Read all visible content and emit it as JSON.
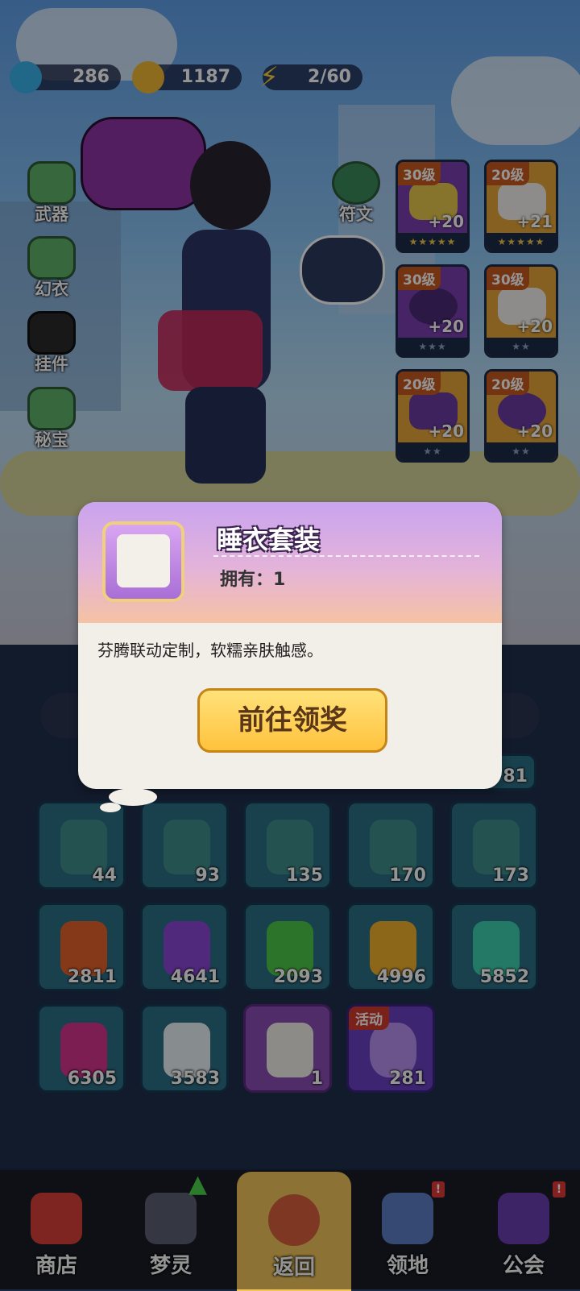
{
  "currencies": {
    "gems": "286",
    "coins": "1187",
    "energy": "2/60"
  },
  "side_menu": [
    {
      "label": "武器"
    },
    {
      "label": "幻衣"
    },
    {
      "label": "挂件"
    },
    {
      "label": "秘宝"
    }
  ],
  "rune_label": "符文",
  "equipment": [
    {
      "level": "30级",
      "bonus": "+20",
      "stars": "★★★★★"
    },
    {
      "level": "20级",
      "bonus": "+21",
      "stars": "★★★★★"
    },
    {
      "level": "30级",
      "bonus": "+20",
      "stars": "★★★"
    },
    {
      "level": "30级",
      "bonus": "+20",
      "stars": "★★"
    },
    {
      "level": "20级",
      "bonus": "+20",
      "stars": "★★"
    },
    {
      "level": "20级",
      "bonus": "+20",
      "stars": "★★"
    }
  ],
  "popup": {
    "title": "睡衣套装",
    "owned": "拥有：1",
    "description": "芬腾联动定制，软糯亲肤触感。",
    "button": "前往领奖"
  },
  "inventory": {
    "row0_partial": [
      "81"
    ],
    "row1": [
      "44",
      "93",
      "135",
      "170",
      "173"
    ],
    "row2": [
      "2811",
      "4641",
      "2093",
      "4996",
      "5852"
    ],
    "row3": [
      "6305",
      "3583",
      "1",
      "281"
    ],
    "event_tag": "活动"
  },
  "nav": [
    {
      "label": "商店"
    },
    {
      "label": "梦灵"
    },
    {
      "label": "返回"
    },
    {
      "label": "领地",
      "badge": "!"
    },
    {
      "label": "公会",
      "badge": "!"
    }
  ],
  "colors": {
    "accent_yellow": "#ffc23d",
    "popup_header": "#c9a4ef",
    "cell_teal": "#2c6e85"
  }
}
